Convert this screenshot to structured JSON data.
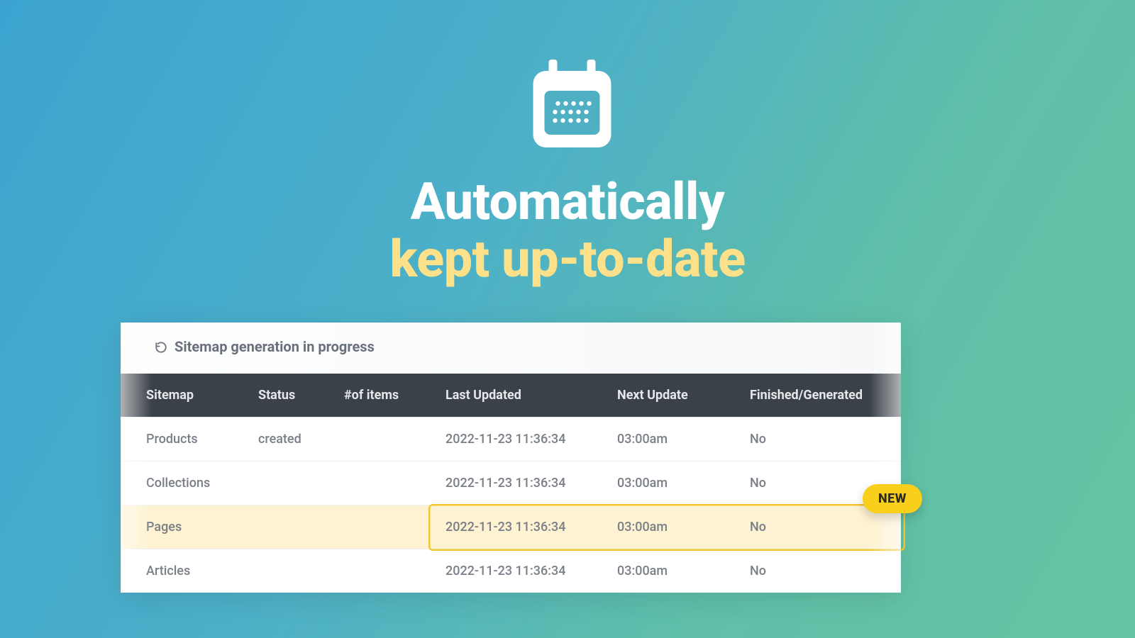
{
  "headline": {
    "line1": "Automatically",
    "line2": "kept up-to-date"
  },
  "status_bar": {
    "text": "Sitemap generation in progress"
  },
  "badge": {
    "label": "NEW"
  },
  "table": {
    "headers": {
      "sitemap": "Sitemap",
      "status": "Status",
      "items": "#of items",
      "last_updated": "Last Updated",
      "next_update": "Next Update",
      "finished": "Finished/Generated"
    },
    "rows": [
      {
        "sitemap": "Products",
        "status": "created",
        "items": "",
        "last_updated": "2022-11-23 11:36:34",
        "next_update": "03:00am",
        "finished": "No",
        "highlight": false
      },
      {
        "sitemap": "Collections",
        "status": "",
        "items": "",
        "last_updated": "2022-11-23 11:36:34",
        "next_update": "03:00am",
        "finished": "No",
        "highlight": false
      },
      {
        "sitemap": "Pages",
        "status": "",
        "items": "",
        "last_updated": "2022-11-23 11:36:34",
        "next_update": "03:00am",
        "finished": "No",
        "highlight": true
      },
      {
        "sitemap": "Articles",
        "status": "",
        "items": "",
        "last_updated": "2022-11-23 11:36:34",
        "next_update": "03:00am",
        "finished": "No",
        "highlight": false
      }
    ]
  }
}
